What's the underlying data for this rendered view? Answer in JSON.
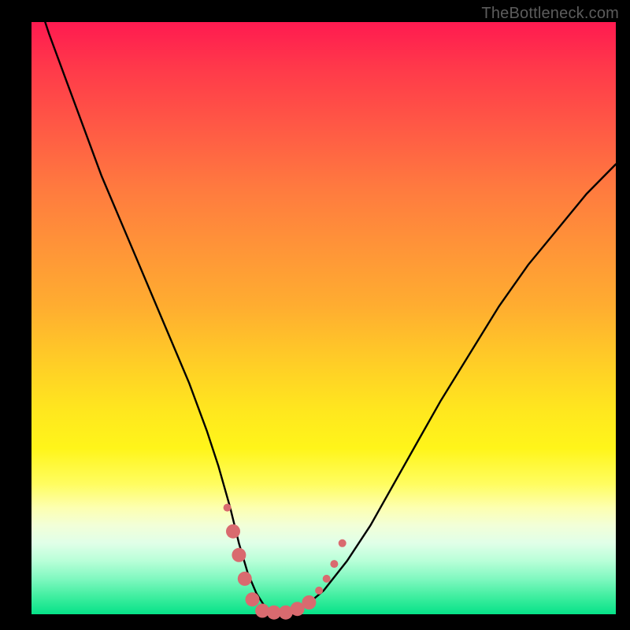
{
  "watermark": "TheBottleneck.com",
  "chart_data": {
    "type": "line",
    "title": "",
    "xlabel": "",
    "ylabel": "",
    "xlim": [
      0,
      100
    ],
    "ylim": [
      0,
      100
    ],
    "grid": false,
    "series": [
      {
        "name": "bottleneck-curve",
        "color": "#000000",
        "x": [
          0,
          3,
          6,
          9,
          12,
          15,
          18,
          21,
          24,
          27,
          30,
          32,
          34,
          35.5,
          37,
          38.5,
          40,
          42,
          44,
          47,
          50,
          54,
          58,
          62,
          66,
          70,
          75,
          80,
          85,
          90,
          95,
          100
        ],
        "y": [
          107,
          98,
          90,
          82,
          74,
          67,
          60,
          53,
          46,
          39,
          31,
          25,
          18,
          12,
          7,
          3.5,
          1.2,
          0.3,
          0.3,
          1.5,
          4,
          9,
          15,
          22,
          29,
          36,
          44,
          52,
          59,
          65,
          71,
          76
        ]
      }
    ],
    "markers": {
      "name": "valley-dots",
      "color": "#d96a6f",
      "radius_small": 5,
      "radius_large": 9,
      "points": [
        {
          "x": 33.5,
          "y": 18,
          "r": "small"
        },
        {
          "x": 34.5,
          "y": 14,
          "r": "large"
        },
        {
          "x": 35.5,
          "y": 10,
          "r": "large"
        },
        {
          "x": 36.5,
          "y": 6,
          "r": "large"
        },
        {
          "x": 37.8,
          "y": 2.5,
          "r": "large"
        },
        {
          "x": 39.5,
          "y": 0.6,
          "r": "large"
        },
        {
          "x": 41.5,
          "y": 0.3,
          "r": "large"
        },
        {
          "x": 43.5,
          "y": 0.3,
          "r": "large"
        },
        {
          "x": 45.5,
          "y": 0.9,
          "r": "large"
        },
        {
          "x": 47.5,
          "y": 2.0,
          "r": "large"
        },
        {
          "x": 49.2,
          "y": 4.0,
          "r": "small"
        },
        {
          "x": 50.5,
          "y": 6.0,
          "r": "small"
        },
        {
          "x": 51.8,
          "y": 8.5,
          "r": "small"
        },
        {
          "x": 53.2,
          "y": 12,
          "r": "small"
        }
      ]
    }
  }
}
